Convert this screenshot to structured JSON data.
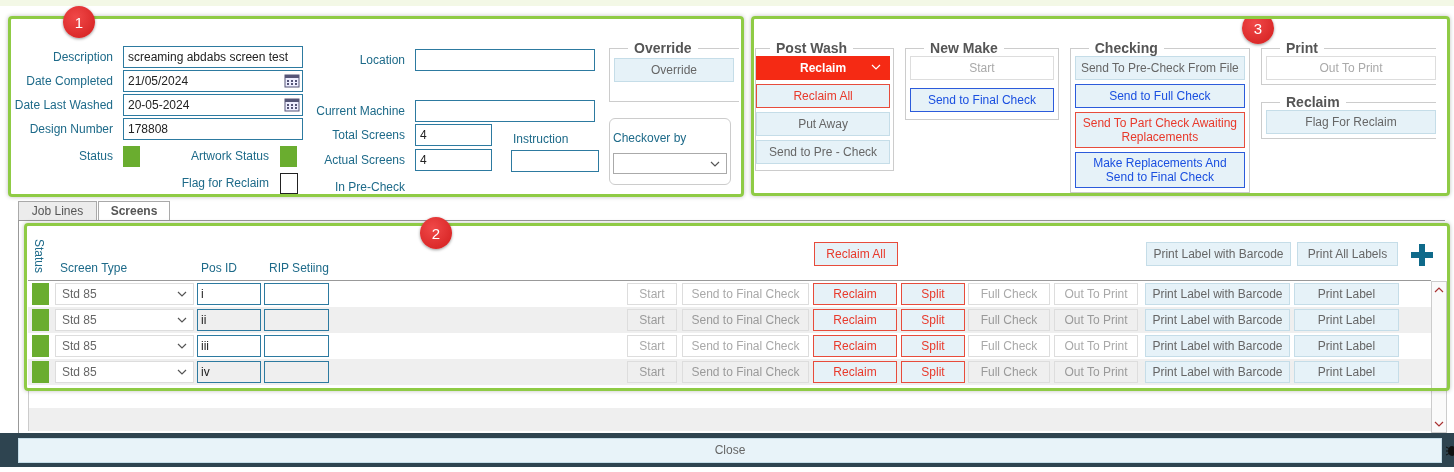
{
  "details": {
    "callout": "1",
    "fields_left": [
      {
        "label": "Description",
        "value": "screaming abdabs screen test",
        "kind": "text"
      },
      {
        "label": "Date Completed",
        "value": "21/05/2024",
        "kind": "date"
      },
      {
        "label": "Date Last Washed",
        "value": "20-05-2024",
        "kind": "date"
      },
      {
        "label": "Design Number",
        "value": "178808",
        "kind": "text"
      }
    ],
    "status": {
      "label": "Status",
      "color": "#6aad2f"
    },
    "artwork_status": {
      "label": "Artwork Status",
      "color": "#6aad2f"
    },
    "flag_for_reclaim": {
      "label": "Flag for Reclaim",
      "checked": false
    },
    "location": {
      "label": "Location"
    },
    "current_machine": {
      "label": "Current Machine"
    },
    "total_screens": {
      "label": "Total Screens",
      "value": "4"
    },
    "actual_screens": {
      "label": "Actual Screens",
      "value": "4"
    },
    "in_pre_check": {
      "label": "In Pre-Check"
    },
    "instruction": {
      "label": "Instruction"
    },
    "override": {
      "title": "Override",
      "button": "Override"
    },
    "checkover_by": {
      "label": "Checkover by"
    }
  },
  "actions": {
    "callout": "3",
    "groups": [
      {
        "title": "Post Wash",
        "buttons": [
          {
            "label": "Reclaim",
            "kind": "dropdown"
          },
          {
            "label": "Reclaim All",
            "kind": "red"
          },
          {
            "label": "Put Away",
            "kind": "plain"
          },
          {
            "label": "Send to Pre - Check",
            "kind": "plain"
          }
        ]
      },
      {
        "title": "New Make",
        "buttons": [
          {
            "label": "Start",
            "kind": "disabled"
          },
          {
            "label": "Send to Final Check",
            "kind": "blue"
          }
        ]
      },
      {
        "title": "Checking",
        "buttons": [
          {
            "label": "Send To Pre-Check From File",
            "kind": "plain"
          },
          {
            "label": "Send to Full Check",
            "kind": "blue"
          },
          {
            "label": "Send To Part Check Awaiting Replacements",
            "kind": "red"
          },
          {
            "label": "Make Replacements And Send to Final Check",
            "kind": "blue"
          }
        ]
      },
      {
        "title": "Print",
        "buttons": [
          {
            "label": "Out To Print",
            "kind": "disabled"
          }
        ]
      },
      {
        "title": "Reclaim",
        "buttons": [
          {
            "label": "Flag For Reclaim",
            "kind": "plain"
          }
        ]
      }
    ]
  },
  "tabs": [
    {
      "label": "Job Lines",
      "selected": false
    },
    {
      "label": "Screens",
      "selected": true
    }
  ],
  "screens": {
    "callout": "2",
    "status_heading": "Status",
    "columns": [
      "Screen Type",
      "Pos ID",
      "RIP Setiing"
    ],
    "header_buttons": [
      {
        "label": "Reclaim All",
        "kind": "red"
      },
      {
        "label": "Print Label with Barcode",
        "kind": "plain"
      },
      {
        "label": "Print All Labels",
        "kind": "plain"
      }
    ],
    "rows": [
      {
        "color": "#6aad2f",
        "screen_type": "Std 85",
        "pos_id": "i",
        "actions": [
          {
            "label": "Start",
            "kind": "disabled"
          },
          {
            "label": "Send to Final Check",
            "kind": "disabled"
          },
          {
            "label": "Reclaim",
            "kind": "red"
          },
          {
            "label": "Split",
            "kind": "red"
          },
          {
            "label": "Full Check",
            "kind": "disabled"
          },
          {
            "label": "Out To Print",
            "kind": "disabled"
          },
          {
            "label": "Print Label with Barcode",
            "kind": "plain"
          },
          {
            "label": "Print Label",
            "kind": "plain"
          }
        ]
      },
      {
        "color": "#6aad2f",
        "screen_type": "Std 85",
        "pos_id": "ii",
        "actions": [
          {
            "label": "Start",
            "kind": "disabled"
          },
          {
            "label": "Send to Final Check",
            "kind": "disabled"
          },
          {
            "label": "Reclaim",
            "kind": "red"
          },
          {
            "label": "Split",
            "kind": "red"
          },
          {
            "label": "Full Check",
            "kind": "disabled"
          },
          {
            "label": "Out To Print",
            "kind": "disabled"
          },
          {
            "label": "Print Label with Barcode",
            "kind": "plain"
          },
          {
            "label": "Print Label",
            "kind": "plain"
          }
        ]
      },
      {
        "color": "#6aad2f",
        "screen_type": "Std 85",
        "pos_id": "iii",
        "actions": [
          {
            "label": "Start",
            "kind": "disabled"
          },
          {
            "label": "Send to Final Check",
            "kind": "disabled"
          },
          {
            "label": "Reclaim",
            "kind": "red"
          },
          {
            "label": "Split",
            "kind": "red"
          },
          {
            "label": "Full Check",
            "kind": "disabled"
          },
          {
            "label": "Out To Print",
            "kind": "disabled"
          },
          {
            "label": "Print Label with Barcode",
            "kind": "plain"
          },
          {
            "label": "Print Label",
            "kind": "plain"
          }
        ]
      },
      {
        "color": "#6aad2f",
        "screen_type": "Std 85",
        "pos_id": "iv",
        "actions": [
          {
            "label": "Start",
            "kind": "disabled"
          },
          {
            "label": "Send to Final Check",
            "kind": "disabled"
          },
          {
            "label": "Reclaim",
            "kind": "red"
          },
          {
            "label": "Split",
            "kind": "red"
          },
          {
            "label": "Full Check",
            "kind": "disabled"
          },
          {
            "label": "Out To Print",
            "kind": "disabled"
          },
          {
            "label": "Print Label with Barcode",
            "kind": "plain"
          },
          {
            "label": "Print Label",
            "kind": "plain"
          }
        ]
      }
    ]
  },
  "close_button": "Close"
}
